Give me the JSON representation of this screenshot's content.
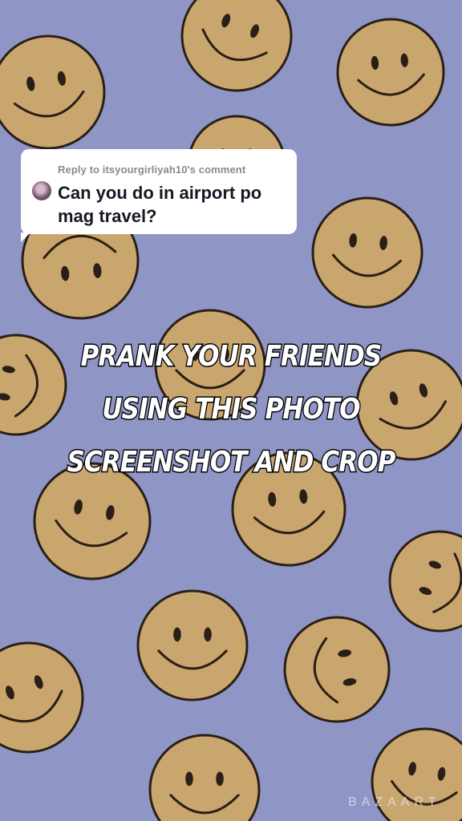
{
  "background": {
    "color": "#8f96c6",
    "pattern": "smiley-face-icon",
    "face_color": "#c9a66d",
    "line_color": "#2a1f16"
  },
  "reply": {
    "header": "Reply to itsyourgirliyah10's comment",
    "text": "Can you do in airport po mag travel?"
  },
  "caption": {
    "line1": "PRANK YOUR FRIENDS",
    "line2": "USING THIS PHOTO",
    "line3": "SCREENSHOT AND CROP"
  },
  "watermark": "BAZAART"
}
